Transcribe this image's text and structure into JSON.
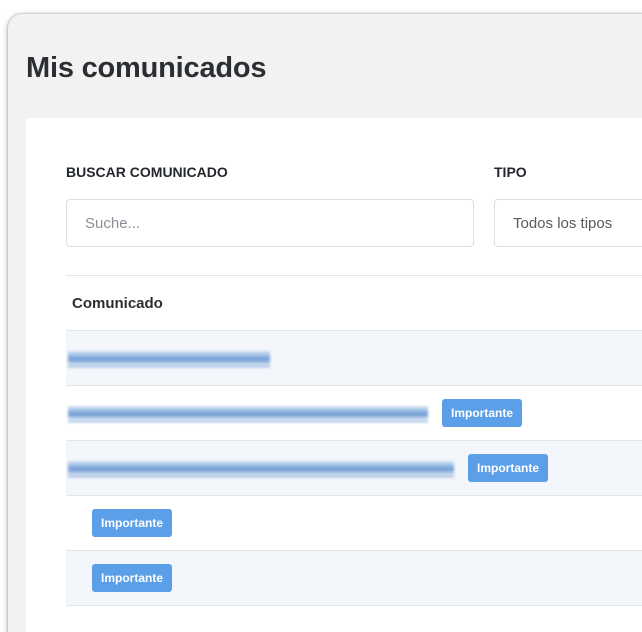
{
  "page": {
    "title": "Mis comunicados"
  },
  "filters": {
    "search_label": "BUSCAR COMUNICADO",
    "search_placeholder": "Suche...",
    "search_value": "",
    "type_label": "TIPO",
    "type_selected": "Todos los tipos"
  },
  "table": {
    "column_header": "Comunicado",
    "rows": [
      {
        "badge": ""
      },
      {
        "badge": "Importante"
      },
      {
        "badge": "Importante"
      },
      {
        "badge": "Importante"
      },
      {
        "badge": "Importante"
      }
    ]
  },
  "colors": {
    "badge_bg": "#5a9fe8",
    "link": "#6f9bd3",
    "row_alt_bg": "#f3f6fa"
  }
}
